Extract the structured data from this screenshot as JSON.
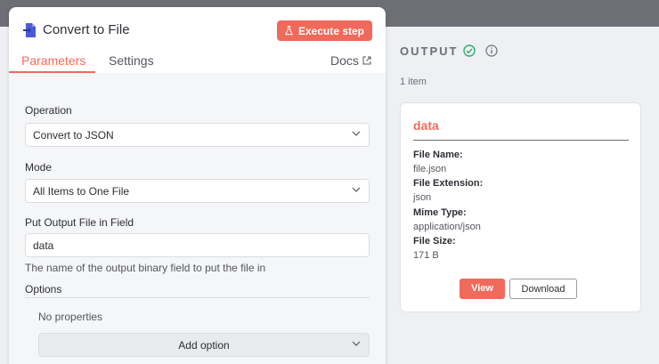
{
  "node": {
    "title": "Convert to File",
    "execute_label": "Execute step"
  },
  "tabs": [
    {
      "label": "Parameters",
      "active": true
    },
    {
      "label": "Settings",
      "active": false
    }
  ],
  "docs_label": "Docs",
  "params": {
    "operation_label": "Operation",
    "operation_value": "Convert to JSON",
    "mode_label": "Mode",
    "mode_value": "All Items to One File",
    "output_field_label": "Put Output File in Field",
    "output_field_value": "data",
    "output_field_hint": "The name of the output binary field to put the file in",
    "options_label": "Options",
    "no_properties": "No properties",
    "add_option_label": "Add option"
  },
  "output": {
    "title": "OUTPUT",
    "item_count": "1 item",
    "card": {
      "title": "data",
      "fields": [
        {
          "key": "File Name:",
          "value": "file.json"
        },
        {
          "key": "File Extension:",
          "value": "json"
        },
        {
          "key": "Mime Type:",
          "value": "application/json"
        },
        {
          "key": "File Size:",
          "value": "171 B"
        }
      ],
      "view_label": "View",
      "download_label": "Download"
    }
  },
  "colors": {
    "accent": "#f06a5b",
    "success": "#2eab6d",
    "backdrop": "#6e6e77"
  },
  "icons": [
    "convert-file-icon",
    "flask-icon",
    "external-link-icon",
    "chevron-down-icon",
    "success-check-icon",
    "info-icon"
  ]
}
